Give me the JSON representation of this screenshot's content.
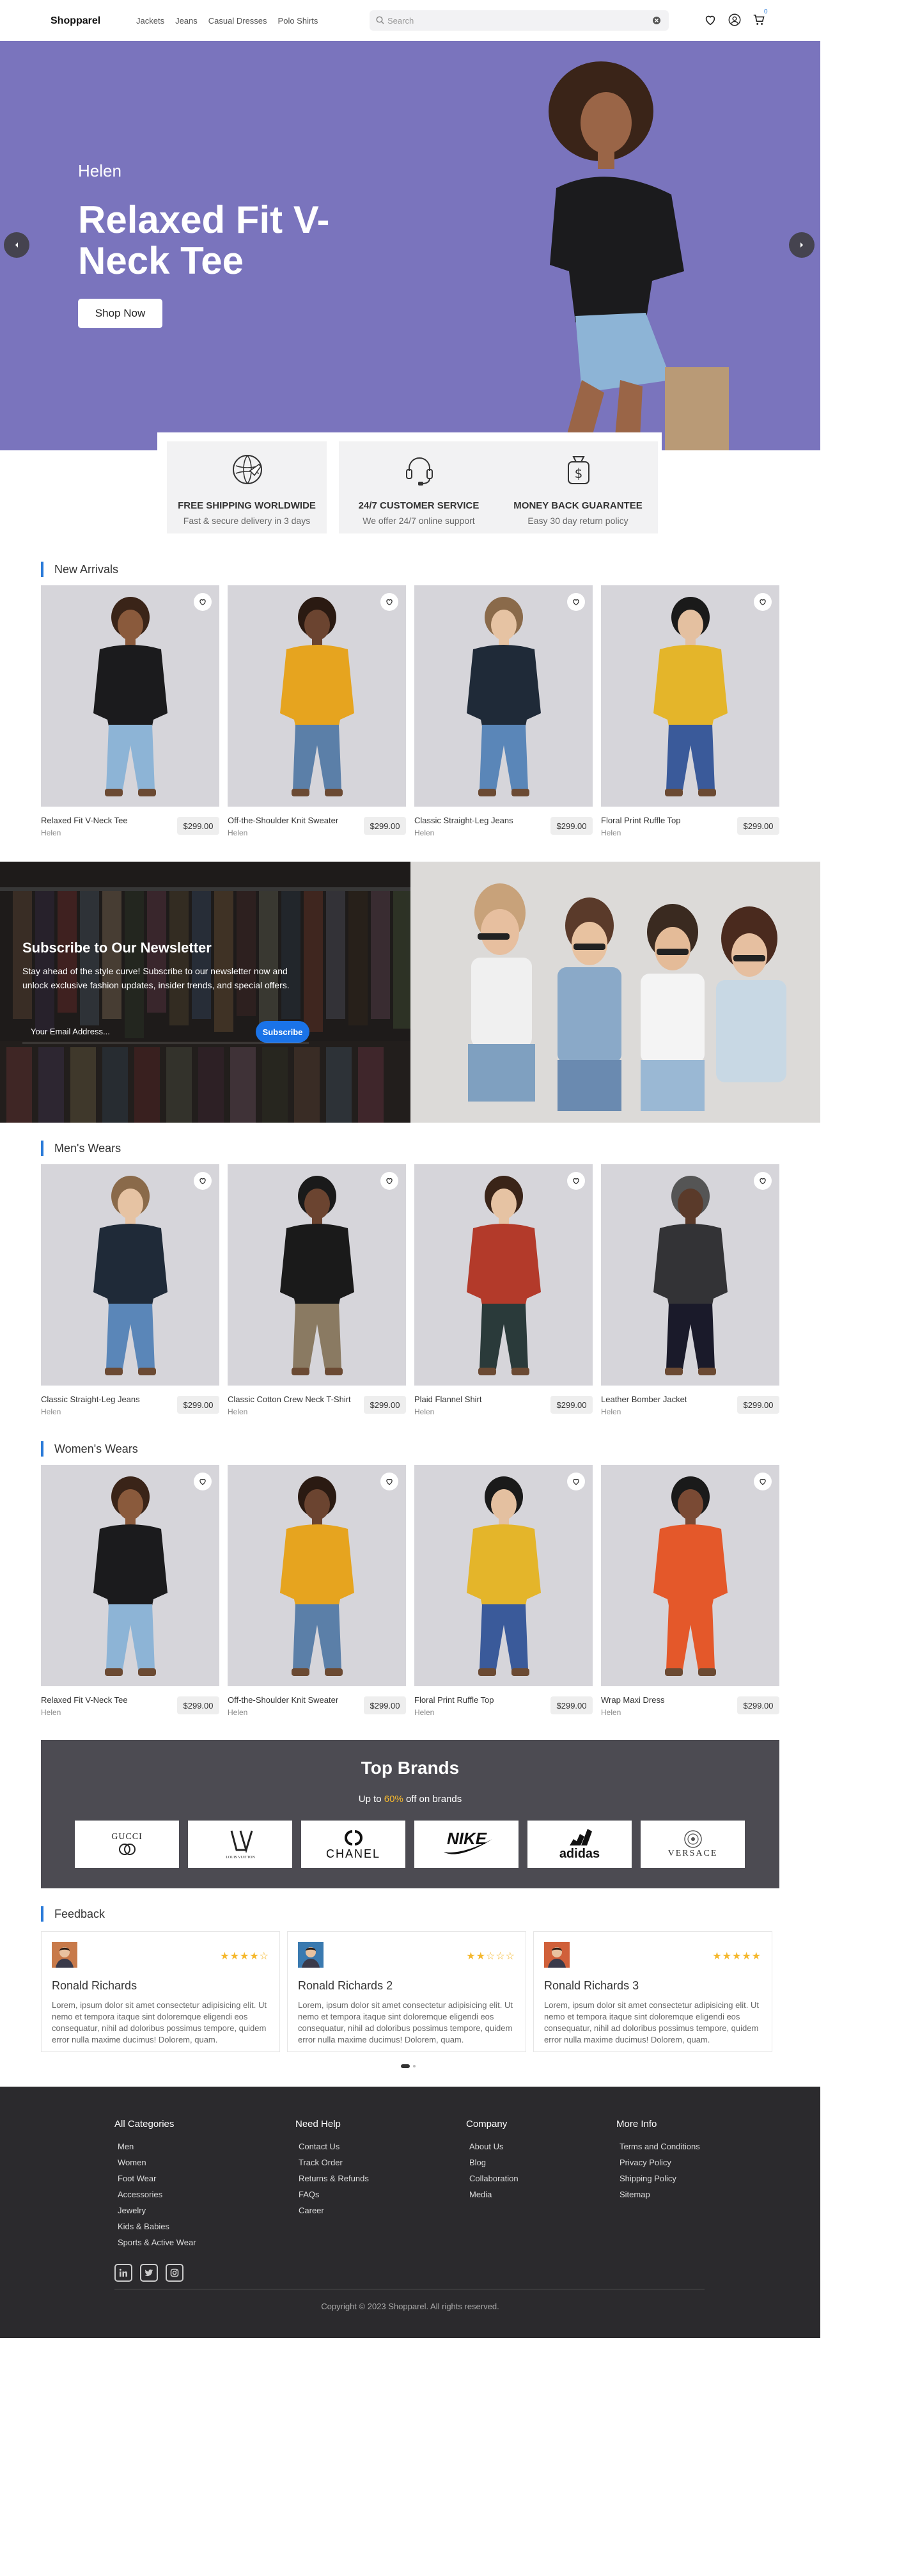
{
  "header": {
    "logo": "Shopparel",
    "nav": [
      "Jackets",
      "Jeans",
      "Casual Dresses",
      "Polo Shirts"
    ],
    "search_placeholder": "Search",
    "cart_count": "0"
  },
  "hero": {
    "subtitle": "Helen",
    "title": "Relaxed Fit V-Neck Tee",
    "button": "Shop Now",
    "bg_color": "#7a74bd"
  },
  "features": [
    {
      "icon": "globe-plane-icon",
      "title": "FREE SHIPPING WORLDWIDE",
      "desc": "Fast & secure delivery in 3 days"
    },
    {
      "icon": "headset-icon",
      "title": "24/7 CUSTOMER SERVICE",
      "desc": "We offer 24/7 online support"
    },
    {
      "icon": "money-bag-icon",
      "title": "MONEY BACK GUARANTEE",
      "desc": "Easy 30 day return policy"
    }
  ],
  "sections": {
    "new_arrivals": {
      "title": "New Arrivals",
      "products": [
        {
          "name": "Relaxed Fit V-Neck Tee",
          "brand": "Helen",
          "price": "$299.00"
        },
        {
          "name": "Off-the-Shoulder Knit Sweater",
          "brand": "Helen",
          "price": "$299.00"
        },
        {
          "name": "Classic Straight-Leg Jeans",
          "brand": "Helen",
          "price": "$299.00"
        },
        {
          "name": "Floral Print Ruffle Top",
          "brand": "Helen",
          "price": "$299.00"
        }
      ]
    },
    "mens": {
      "title": "Men's Wears",
      "products": [
        {
          "name": "Classic Straight-Leg Jeans",
          "brand": "Helen",
          "price": "$299.00"
        },
        {
          "name": "Classic Cotton Crew Neck T-Shirt",
          "brand": "Helen",
          "price": "$299.00"
        },
        {
          "name": "Plaid Flannel Shirt",
          "brand": "Helen",
          "price": "$299.00"
        },
        {
          "name": "Leather Bomber Jacket",
          "brand": "Helen",
          "price": "$299.00"
        }
      ]
    },
    "womens": {
      "title": "Women's Wears",
      "products": [
        {
          "name": "Relaxed Fit V-Neck Tee",
          "brand": "Helen",
          "price": "$299.00"
        },
        {
          "name": "Off-the-Shoulder Knit Sweater",
          "brand": "Helen",
          "price": "$299.00"
        },
        {
          "name": "Floral Print Ruffle Top",
          "brand": "Helen",
          "price": "$299.00"
        },
        {
          "name": "Wrap Maxi Dress",
          "brand": "Helen",
          "price": "$299.00"
        }
      ]
    }
  },
  "newsletter": {
    "title": "Subscribe to Our Newsletter",
    "desc": "Stay ahead of the style curve! Subscribe to our newsletter now and unlock exclusive fashion updates, insider trends, and special offers.",
    "placeholder": "Your Email Address...",
    "button": "Subscribe"
  },
  "brands": {
    "title": "Top Brands",
    "sub_prefix": "Up to ",
    "sub_highlight": "60%",
    "sub_suffix": " off on brands",
    "logos": [
      "GUCCI",
      "Louis Vuitton",
      "CHANEL",
      "NIKE",
      "adidas",
      "VERSACE"
    ]
  },
  "feedback": {
    "title": "Feedback",
    "reviews": [
      {
        "name": "Ronald Richards",
        "rating": 4,
        "text": "Lorem, ipsum dolor sit amet consectetur adipisicing elit. Ut nemo et tempora itaque sint doloremque eligendi eos consequatur, nihil ad doloribus possimus tempore, quidem error nulla maxime ducimus! Dolorem, quam."
      },
      {
        "name": "Ronald Richards 2",
        "rating": 2,
        "text": "Lorem, ipsum dolor sit amet consectetur adipisicing elit. Ut nemo et tempora itaque sint doloremque eligendi eos consequatur, nihil ad doloribus possimus tempore, quidem error nulla maxime ducimus! Dolorem, quam."
      },
      {
        "name": "Ronald Richards 3",
        "rating": 5,
        "text": "Lorem, ipsum dolor sit amet consectetur adipisicing elit. Ut nemo et tempora itaque sint doloremque eligendi eos consequatur, nihil ad doloribus possimus tempore, quidem error nulla maxime ducimus! Dolorem, quam."
      }
    ]
  },
  "footer": {
    "columns": [
      {
        "title": "All Categories",
        "links": [
          "Men",
          "Women",
          "Foot Wear",
          "Accessories",
          "Jewelry",
          "Kids & Babies",
          "Sports & Active Wear"
        ]
      },
      {
        "title": "Need Help",
        "links": [
          "Contact Us",
          "Track Order",
          "Returns & Refunds",
          "FAQs",
          "Career"
        ]
      },
      {
        "title": "Company",
        "links": [
          "About Us",
          "Blog",
          "Collaboration",
          "Media"
        ]
      },
      {
        "title": "More Info",
        "links": [
          "Terms and Conditions",
          "Privacy Policy",
          "Shipping Policy",
          "Sitemap"
        ]
      }
    ],
    "social": [
      "linkedin-icon",
      "twitter-icon",
      "instagram-icon"
    ],
    "copyright": "Copyright © 2023 Shopparel. All rights reserved."
  },
  "colors": {
    "accent": "#2b7bd9",
    "star": "#f5b82e",
    "footer_bg": "#2b2a2d"
  }
}
